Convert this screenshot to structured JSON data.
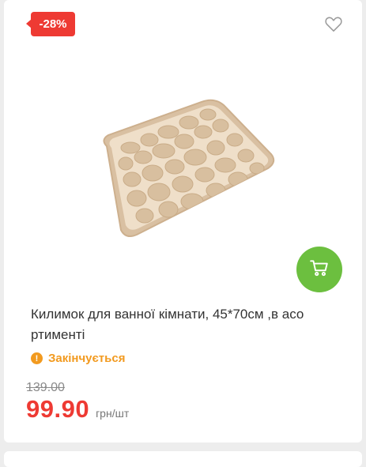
{
  "product": {
    "discount_badge": "-28%",
    "title": "Килимок для ванної кімнати, 45*70см ,в асо ртименті",
    "status_icon": "!",
    "status": "Закінчується",
    "old_price": "139.00",
    "price": "99.90",
    "unit": "грн/шт",
    "icons": {
      "favorite": "heart-outline-icon",
      "cart": "cart-icon",
      "status": "exclamation-circle-icon"
    }
  },
  "colors": {
    "badge": "#ee3a33",
    "price": "#ee3a33",
    "cart_button": "#6cbf3f",
    "status": "#f29a1f",
    "mat": "#e8d4bc"
  }
}
